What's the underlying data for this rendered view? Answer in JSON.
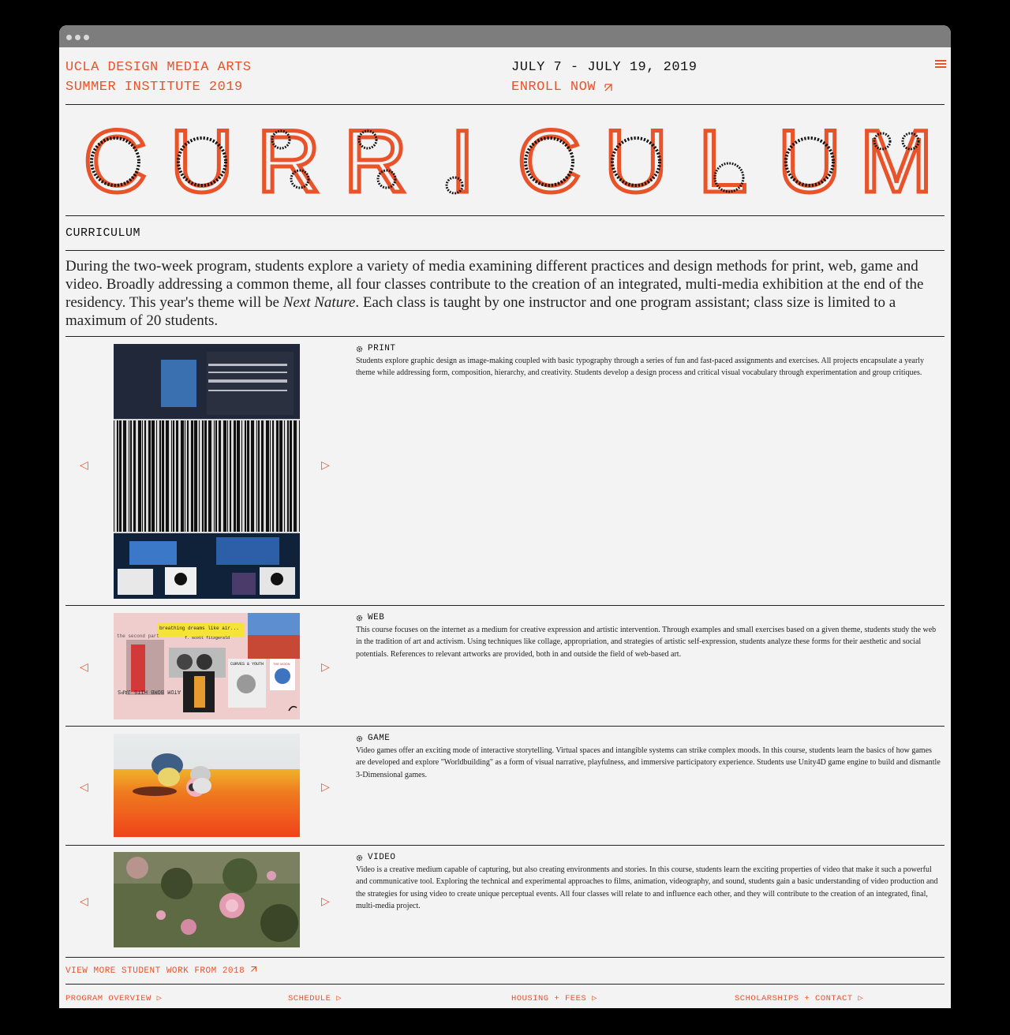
{
  "header": {
    "org_line1": "UCLA DESIGN MEDIA ARTS",
    "org_line2": "SUMMER INSTITUTE 2019",
    "dates": "JULY 7 - JULY 19, 2019",
    "enroll": "ENROLL NOW",
    "menu_icon": "hamburger-icon"
  },
  "hero": {
    "title": "CURRICULUM"
  },
  "section_label": "CURRICULUM",
  "intro": {
    "before": "During the two-week program, students explore a variety of media examining different practices and design methods for print, web, game and video. Broadly addressing a common theme, all four classes contribute to the creation of an integrated, multi-media exhibition at the end of the residency. This year's theme will be ",
    "theme": "Next Nature",
    "after": ". Each class is taught by one instructor and one program assistant; class size is limited to a maximum of 20 students."
  },
  "courses": [
    {
      "title": "PRINT",
      "description": "Students explore graphic design as image-making coupled with basic typography through a series of fun and fast-paced assignments and exercises. All projects encapsulate a yearly theme while addressing form, composition, hierarchy, and creativity. Students develop a design process and critical visual vocabulary through experimentation and group critiques."
    },
    {
      "title": "WEB",
      "description": "This course focuses on the internet as a medium for creative expression and artistic intervention. Through examples and small exercises based on a given theme, students study the web in the tradition of art and activism. Using techniques like collage, appropriation, and strategies of artistic self-expression, students analyze these forms for their aesthetic and social potentials. References to relevant artworks are provided, both in and outside the field of web-based art.",
      "collage_text": [
        "breathing dreams like air...",
        "f. scott fitzgerald",
        "the second part",
        "CURVES & YOUTH",
        "THE MOON",
        "ATOM BOMB HITS JAPS"
      ]
    },
    {
      "title": "GAME",
      "description": "Video games offer an exciting mode of interactive storytelling. Virtual spaces and intangible systems can strike complex moods. In this course, students learn the basics of how games are developed and explore \"Worldbuilding\" as a form of visual narrative, playfulness, and immersive participatory experience. Students use Unity4D game engine to build and dismantle 3-Dimensional games."
    },
    {
      "title": "VIDEO",
      "description": "Video is a creative medium capable of capturing, but also creating environments and stories. In this course, students learn the exciting properties of video that make it such a powerful and communicative tool.  Exploring the technical and experimental approaches to films, animation, videography, and sound, students gain a basic understanding of video production and the strategies for using video to create unique perceptual events. All four classes will relate to and influence each other, and they will contribute to the creation of an integrated, final, multi-media project."
    }
  ],
  "view_more": "VIEW MORE STUDENT WORK FROM 2018",
  "footer": {
    "links": [
      "PROGRAM OVERVIEW",
      "SCHEDULE",
      "HOUSING + FEES",
      "SCHOLARSHIPS + CONTACT"
    ]
  },
  "colors": {
    "accent": "#e8532a",
    "background": "#f4f3f4",
    "rule": "#222222"
  }
}
